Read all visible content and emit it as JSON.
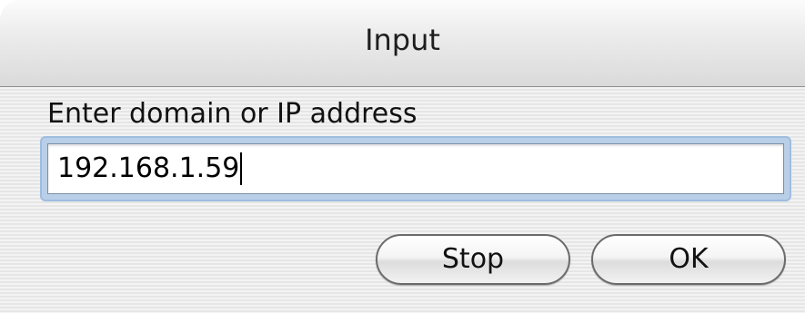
{
  "window": {
    "title": "Input"
  },
  "prompt": {
    "label": "Enter domain or IP address"
  },
  "address_field": {
    "value": "192.168.1.59"
  },
  "buttons": {
    "stop_label": "Stop",
    "ok_label": "OK"
  }
}
